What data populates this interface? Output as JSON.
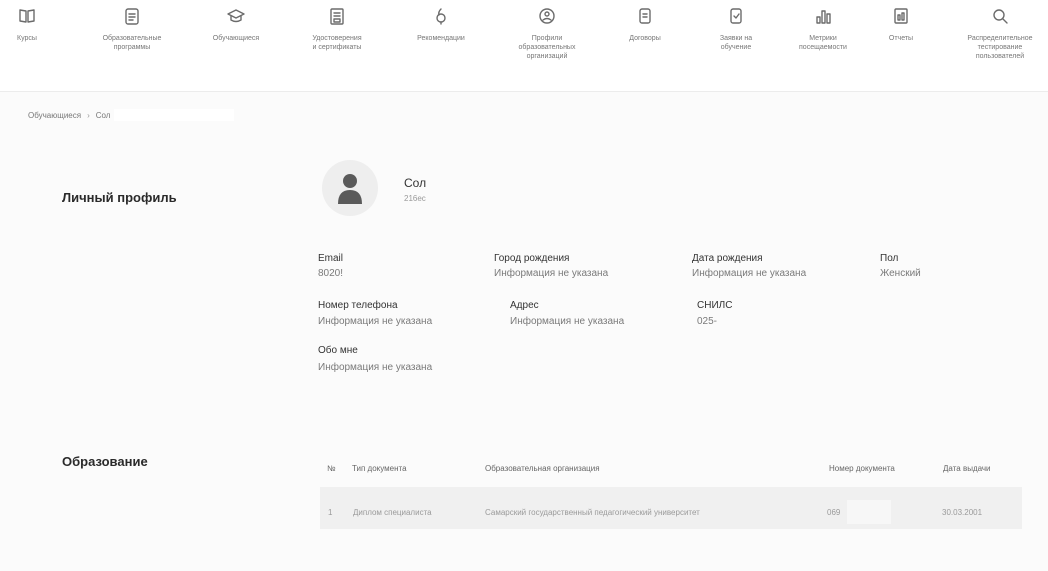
{
  "nav": {
    "items": [
      {
        "label": "Курсы",
        "icon": "book-icon"
      },
      {
        "label": "Образовательные\nпрограммы",
        "icon": "clipboard-icon"
      },
      {
        "label": "Обучающиеся",
        "icon": "graduation-cap-icon"
      },
      {
        "label": "Удостоверения\nи сертификаты",
        "icon": "certificate-icon"
      },
      {
        "label": "Рекомендации",
        "icon": "lightbulb-icon"
      },
      {
        "label": "Профили\nобразовательных\nорганизаций",
        "icon": "building-profile-icon"
      },
      {
        "label": "Договоры",
        "icon": "document-icon"
      },
      {
        "label": "Заявки на\nобучение",
        "icon": "application-icon"
      },
      {
        "label": "Метрики\nпосещаемости",
        "icon": "bar-chart-icon"
      },
      {
        "label": "Отчеты",
        "icon": "report-icon"
      },
      {
        "label": "Распределительное\nтестирование\nпользователей",
        "icon": "search-test-icon"
      }
    ]
  },
  "breadcrumb": {
    "parent": "Обучающиеся",
    "separator": "›",
    "current": "Сол"
  },
  "profile": {
    "section_title": "Личный профиль",
    "name": "Сол",
    "sub": "216ес",
    "fields": {
      "email": {
        "label": "Email",
        "value": "8020!"
      },
      "birth_city": {
        "label": "Город рождения",
        "value": "Информация не указана"
      },
      "birth_date": {
        "label": "Дата рождения",
        "value": "Информация не указана"
      },
      "gender": {
        "label": "Пол",
        "value": "Женский"
      },
      "phone": {
        "label": "Номер телефона",
        "value": "Информация не указана"
      },
      "address": {
        "label": "Адрес",
        "value": "Информация не указана"
      },
      "snils": {
        "label": "СНИЛС",
        "value": "025-"
      },
      "about": {
        "label": "Обо мне",
        "value": "Информация не указана"
      }
    }
  },
  "education": {
    "section_title": "Образование",
    "columns": [
      "№",
      "Тип документа",
      "Образовательная организация",
      "Номер документа",
      "Дата выдачи"
    ],
    "rows": [
      {
        "num": "1",
        "doc_type": "Диплом специалиста",
        "organization": "Самарский государственный педагогический университет",
        "doc_number": "069",
        "issue_date": "30.03.2001"
      }
    ]
  }
}
